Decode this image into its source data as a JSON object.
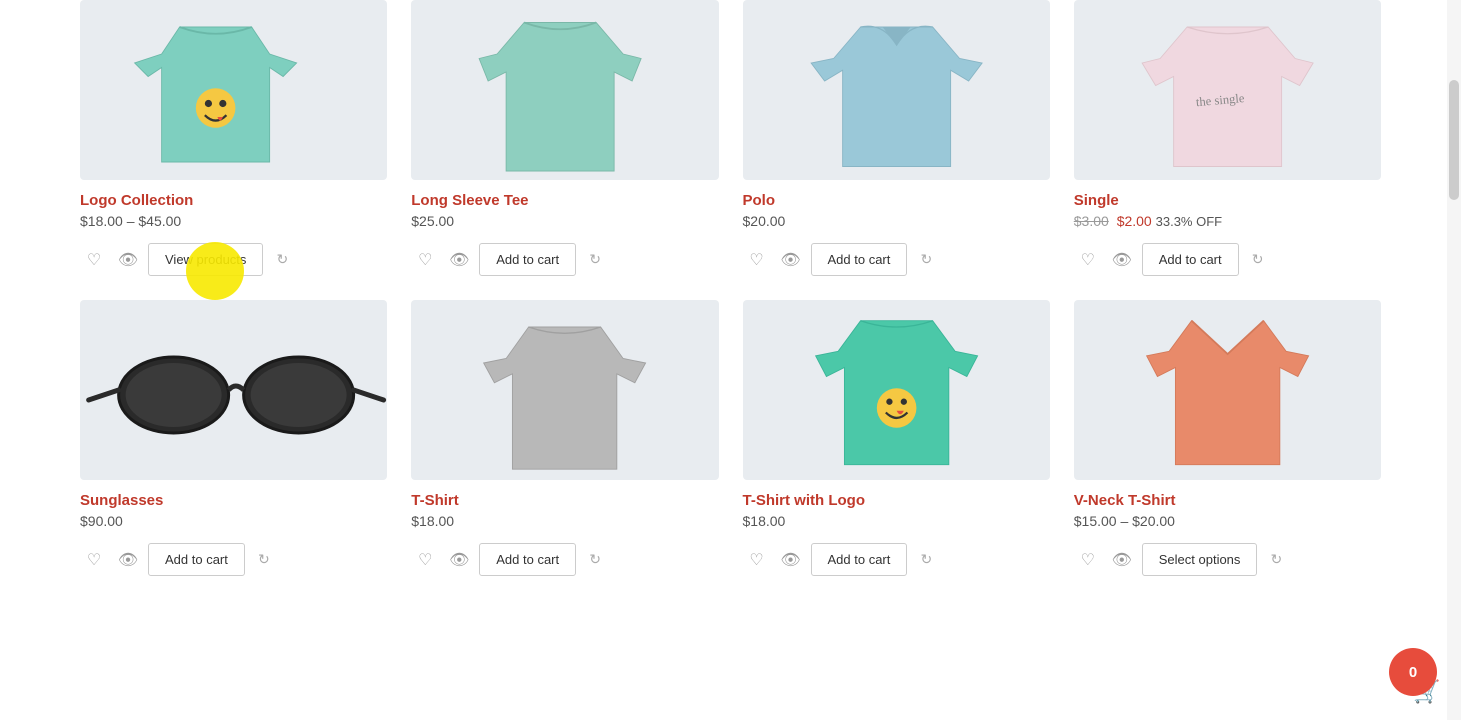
{
  "products": {
    "row1": [
      {
        "id": "logo-collection",
        "name": "Logo Collection",
        "price_display": "$18.00 – $45.00",
        "price_min": "18.00",
        "price_max": "45.00",
        "action_label": "View products",
        "action_type": "view"
      },
      {
        "id": "long-sleeve-tee",
        "name": "Long Sleeve Tee",
        "price_display": "$25.00",
        "action_label": "Add to cart",
        "action_type": "cart"
      },
      {
        "id": "polo",
        "name": "Polo",
        "price_display": "$20.00",
        "action_label": "Add to cart",
        "action_type": "cart"
      },
      {
        "id": "single",
        "name": "Single",
        "price_display": "$2.00",
        "price_original": "$3.00",
        "discount": "33.3% OFF",
        "action_label": "Add to cart",
        "action_type": "cart"
      }
    ],
    "row2": [
      {
        "id": "sunglasses",
        "name": "Sunglasses",
        "price_display": "$90.00",
        "action_label": "Add to cart",
        "action_type": "cart"
      },
      {
        "id": "t-shirt",
        "name": "T-Shirt",
        "price_display": "$18.00",
        "action_label": "Add to cart",
        "action_type": "cart"
      },
      {
        "id": "t-shirt-with-logo",
        "name": "T-Shirt with Logo",
        "price_display": "$18.00",
        "action_label": "Add to cart",
        "action_type": "cart"
      },
      {
        "id": "v-neck-t-shirt",
        "name": "V-Neck T-Shirt",
        "price_display": "$15.00 – $20.00",
        "price_min": "15.00",
        "price_max": "20.00",
        "action_label": "Select options",
        "action_type": "options"
      }
    ]
  },
  "cart": {
    "count": "0"
  },
  "icons": {
    "heart": "♡",
    "eye": "👁",
    "refresh": "↻"
  }
}
